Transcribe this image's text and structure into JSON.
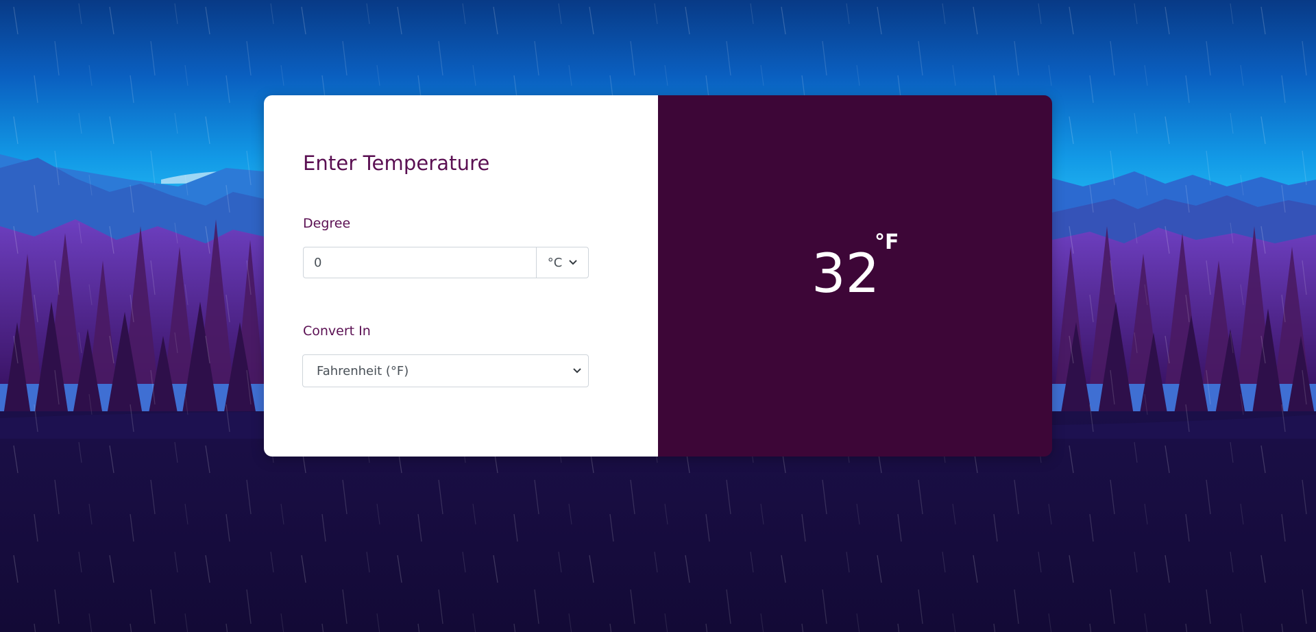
{
  "form": {
    "title": "Enter Temperature",
    "degree_label": "Degree",
    "degree_value": "0",
    "unit_selected": "°C",
    "convert_label": "Convert In",
    "convert_selected": "Fahrenheit (°F)"
  },
  "result": {
    "value": "32",
    "unit": "°F"
  },
  "colors": {
    "accent": "#5a0f52",
    "result_bg": "#3d0637",
    "sky_top": "#0a3f8c",
    "sky_mid": "#11a4ea",
    "ground": "#160d3e"
  },
  "icons": {
    "unit_select": "chevron-down-icon",
    "convert_select": "chevron-down-icon"
  }
}
